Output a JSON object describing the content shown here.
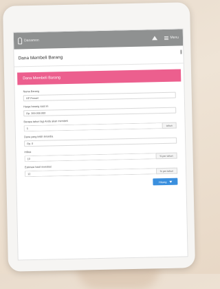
{
  "app": {
    "brand": "Danamon"
  },
  "topbar": {
    "menu_label": "Menu"
  },
  "page": {
    "title": "Dana Membeli Barang"
  },
  "card": {
    "title": "Dana Membeli Barang"
  },
  "form": {
    "fields": [
      {
        "label": "Nama Barang",
        "value": "HP Ponsel",
        "addon": ""
      },
      {
        "label": "Harga barang saat ini",
        "value": "Rp. 200.000.000",
        "addon": ""
      },
      {
        "label": "Berapa tahun lagi Anda akan membeli",
        "value": "5",
        "addon": "tahun"
      },
      {
        "label": "Dana yang telah tersedia",
        "value": "Rp. 0",
        "addon": ""
      },
      {
        "label": "Inflasi",
        "value": "10",
        "addon": "% per tahun"
      },
      {
        "label": "Estimasi hasil investasi",
        "value": "12",
        "addon": "% per tahun"
      }
    ]
  },
  "actions": {
    "calculate_label": "Hitung"
  },
  "colors": {
    "accent": "#ec5f8e",
    "button": "#3a8fde",
    "topbar": "#8f9191"
  }
}
